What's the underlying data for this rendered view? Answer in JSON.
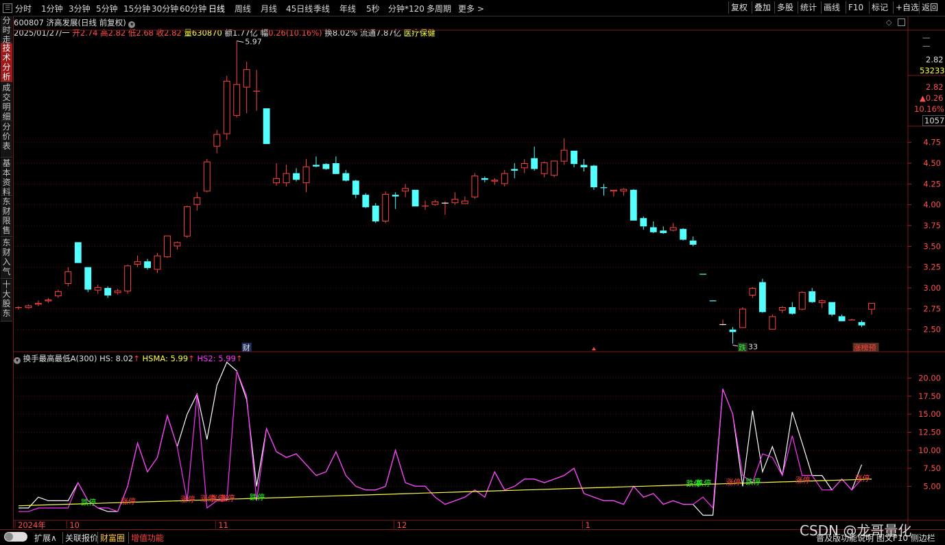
{
  "timeframes": [
    "分时",
    "1分钟",
    "3分钟",
    "5分钟",
    "15分钟",
    "30分钟",
    "60分钟",
    "日线",
    "周线",
    "月线",
    "45日线",
    "季线",
    "年线",
    "5秒",
    "分钟*120",
    "多周期",
    "更多 >"
  ],
  "active_timeframe": "日线",
  "right_buttons": [
    "复权",
    "叠加",
    "多股",
    "统计",
    "画线",
    "F10",
    "标记",
    "+自选",
    "返回"
  ],
  "sidebar": [
    "分时走势",
    "技术分析",
    "成交明细",
    "分价表",
    "基本资料",
    "东财限售",
    "东财入气",
    "十大股东"
  ],
  "stock": {
    "code_name": "600807 济高发展(日线 前复权)",
    "date": "2025/01/27/一",
    "open_label": "开",
    "open": "2.74",
    "high_label": "高",
    "high": "2.82",
    "low_label": "低",
    "low": "2.68",
    "close_label": "收",
    "close": "2.82",
    "vol_label": "量",
    "vol": "630870",
    "amount_label": "额",
    "amount": "1.77亿",
    "chg_label": "幅",
    "chg": "0.26(10.16%)",
    "turnover_label": "换",
    "turnover": "8.02%",
    "float_label": "流通",
    "float": "7.87亿",
    "sector": "医疗保健"
  },
  "right_panel": {
    "price": "2.82",
    "vol": "53233",
    "price2": "2.82",
    "chg": "▲0.26",
    "pct": "10.16%",
    "num": "1057"
  },
  "price_axis": [
    "4.75",
    "4.50",
    "4.25",
    "4.00",
    "3.75",
    "3.50",
    "3.25",
    "3.00",
    "2.75",
    "2.50"
  ],
  "max_label": "5.97",
  "min_label": "2.33",
  "markers": {
    "cai": "财",
    "die": "跌",
    "zhang_yu": "涨榜预"
  },
  "indicator": {
    "title": "换手最高最低A(300)",
    "hs": "HS: 8.02",
    "hsma": "HSMA: 5.99",
    "hs2": "HS2: 5.99",
    "axis": [
      "20.00",
      "17.50",
      "15.00",
      "12.50",
      "10.00",
      "7.50",
      "5.00"
    ]
  },
  "date_axis": [
    "2024年",
    "10",
    "11",
    "12",
    "1"
  ],
  "bottom_tabs": [
    "扩展∧",
    "关联报价",
    "财富圈",
    "增值功能"
  ],
  "bottom_right": "普及版功能说明  图文F10  侧边栏",
  "watermark": "CSDN @龙哥量化",
  "colors": {
    "up": "#ff4444",
    "down": "#54ffff",
    "white_line": "#ffffff",
    "magenta": "#ff33ff",
    "yellow": "#ffff44"
  },
  "chart_data": {
    "type": "candlestick",
    "ylim": [
      2.3,
      6.0
    ],
    "candles": [
      [
        2.76,
        2.78,
        2.74,
        2.77
      ],
      [
        2.76,
        2.8,
        2.75,
        2.79
      ],
      [
        2.8,
        2.85,
        2.78,
        2.82
      ],
      [
        2.84,
        2.88,
        2.82,
        2.86
      ],
      [
        2.9,
        2.98,
        2.88,
        2.96
      ],
      [
        3.05,
        3.25,
        3.02,
        3.2
      ],
      [
        3.55,
        3.55,
        3.3,
        3.3
      ],
      [
        3.25,
        3.25,
        2.95,
        2.98
      ],
      [
        2.97,
        3.04,
        2.93,
        3.01
      ],
      [
        3.0,
        3.02,
        2.88,
        2.91
      ],
      [
        2.94,
        2.99,
        2.92,
        2.97
      ],
      [
        2.96,
        3.28,
        2.93,
        3.27
      ],
      [
        3.28,
        3.39,
        3.25,
        3.32
      ],
      [
        3.32,
        3.35,
        3.22,
        3.24
      ],
      [
        3.22,
        3.42,
        3.18,
        3.39
      ],
      [
        3.37,
        3.62,
        3.36,
        3.63
      ],
      [
        3.5,
        3.56,
        3.46,
        3.55
      ],
      [
        3.62,
        3.99,
        3.6,
        3.98
      ],
      [
        4.0,
        4.15,
        3.93,
        4.09
      ],
      [
        4.16,
        4.55,
        4.15,
        4.52
      ],
      [
        4.7,
        4.9,
        4.62,
        4.85
      ],
      [
        4.85,
        5.55,
        4.78,
        5.49
      ],
      [
        5.07,
        5.97,
        5.05,
        5.45
      ],
      [
        5.41,
        5.72,
        5.1,
        5.63
      ],
      [
        5.36,
        5.62,
        5.13,
        5.37
      ],
      [
        5.16,
        5.16,
        4.73,
        4.73
      ],
      [
        4.26,
        4.5,
        4.23,
        4.32
      ],
      [
        4.26,
        4.48,
        4.22,
        4.38
      ],
      [
        4.38,
        4.44,
        4.28,
        4.3
      ],
      [
        4.26,
        4.55,
        4.15,
        4.46
      ],
      [
        4.48,
        4.58,
        4.45,
        4.46
      ],
      [
        4.49,
        4.5,
        4.42,
        4.43
      ],
      [
        4.5,
        4.58,
        4.38,
        4.37
      ],
      [
        4.38,
        4.42,
        4.28,
        4.29
      ],
      [
        4.29,
        4.3,
        4.08,
        4.12
      ],
      [
        4.12,
        4.14,
        3.96,
        3.97
      ],
      [
        3.99,
        4.02,
        3.78,
        3.8
      ],
      [
        3.8,
        4.16,
        3.78,
        4.13
      ],
      [
        4.12,
        4.15,
        3.95,
        4.1
      ],
      [
        4.16,
        4.25,
        4.09,
        4.2
      ],
      [
        4.18,
        4.18,
        3.98,
        3.98
      ],
      [
        3.98,
        4.05,
        3.94,
        3.99
      ],
      [
        4.0,
        4.06,
        3.99,
        4.04
      ],
      [
        4.02,
        4.04,
        3.88,
        4.02
      ],
      [
        4.02,
        4.15,
        4.0,
        4.07
      ],
      [
        4.01,
        4.1,
        4.01,
        4.05
      ],
      [
        4.09,
        4.38,
        4.07,
        4.35
      ],
      [
        4.32,
        4.34,
        4.27,
        4.3
      ],
      [
        4.28,
        4.32,
        4.24,
        4.3
      ],
      [
        4.25,
        4.42,
        4.22,
        4.38
      ],
      [
        4.43,
        4.5,
        4.32,
        4.41
      ],
      [
        4.44,
        4.55,
        4.38,
        4.5
      ],
      [
        4.56,
        4.7,
        4.41,
        4.43
      ],
      [
        4.37,
        4.52,
        4.33,
        4.51
      ],
      [
        4.35,
        4.52,
        4.33,
        4.53
      ],
      [
        4.52,
        4.8,
        4.48,
        4.66
      ],
      [
        4.65,
        4.65,
        4.45,
        4.49
      ],
      [
        4.48,
        4.55,
        4.4,
        4.45
      ],
      [
        4.47,
        4.48,
        4.18,
        4.21
      ],
      [
        4.21,
        4.25,
        4.11,
        4.2
      ],
      [
        4.16,
        4.18,
        4.1,
        4.18
      ],
      [
        4.16,
        4.2,
        4.11,
        4.19
      ],
      [
        4.18,
        4.19,
        3.81,
        3.81
      ],
      [
        3.84,
        3.86,
        3.7,
        3.74
      ],
      [
        3.73,
        3.8,
        3.66,
        3.67
      ],
      [
        3.69,
        3.74,
        3.65,
        3.66
      ],
      [
        3.69,
        3.78,
        3.68,
        3.73
      ],
      [
        3.71,
        3.72,
        3.57,
        3.58
      ],
      [
        3.57,
        3.62,
        3.5,
        3.52
      ],
      [
        3.17,
        3.17,
        3.16,
        3.16
      ],
      [
        2.85,
        2.85,
        2.84,
        2.84
      ],
      [
        2.56,
        2.62,
        2.55,
        2.56
      ],
      [
        2.5,
        2.53,
        2.33,
        2.47
      ],
      [
        2.52,
        2.77,
        2.52,
        2.75
      ],
      [
        2.91,
        3.01,
        2.88,
        3.0
      ],
      [
        3.07,
        3.11,
        2.7,
        2.71
      ],
      [
        2.5,
        2.68,
        2.5,
        2.66
      ],
      [
        2.73,
        2.78,
        2.7,
        2.77
      ],
      [
        2.77,
        2.83,
        2.68,
        2.69
      ],
      [
        2.74,
        2.96,
        2.73,
        2.95
      ],
      [
        2.96,
        3.0,
        2.82,
        2.83
      ],
      [
        2.82,
        2.86,
        2.76,
        2.85
      ],
      [
        2.83,
        2.83,
        2.66,
        2.68
      ],
      [
        2.66,
        2.68,
        2.6,
        2.6
      ],
      [
        2.61,
        2.63,
        2.61,
        2.62
      ],
      [
        2.59,
        2.61,
        2.53,
        2.55
      ],
      [
        2.74,
        2.82,
        2.68,
        2.82
      ]
    ],
    "hs": [
      2.0,
      2.0,
      3.5,
      3.0,
      3.0,
      3.0,
      5.5,
      3.0,
      2.0,
      1.5,
      1.5,
      5.0,
      11.0,
      7.0,
      9.0,
      14.8,
      10.5,
      15.0,
      17.8,
      11.5,
      19.0,
      22.2,
      21.0,
      17.0,
      5.0,
      13.0,
      9.8,
      9.0,
      9.5,
      8.0,
      6.5,
      7.0,
      9.8,
      6.5,
      5.0,
      4.5,
      4.5,
      5.0,
      10.0,
      5.5,
      5.0,
      5.0,
      3.5,
      2.5,
      3.0,
      3.5,
      4.5,
      3.5,
      7.0,
      4.5,
      5.0,
      6.0,
      6.0,
      5.5,
      6.0,
      6.5,
      7.5,
      4.0,
      3.5,
      3.0,
      3.0,
      2.5,
      5.0,
      3.5,
      4.0,
      2.5,
      3.0,
      2.5,
      2.5,
      1.0,
      1.0,
      18.5,
      15.0,
      5.0,
      15.5,
      7.0,
      10.5,
      6.5,
      15.3,
      11.0,
      6.5,
      6.5,
      4.5,
      6.0,
      4.5,
      8.0
    ],
    "hs2": [
      1.5,
      1.5,
      2.0,
      2.0,
      2.0,
      2.0,
      5.5,
      3.0,
      2.0,
      2.0,
      1.5,
      5.0,
      11.0,
      7.0,
      9.0,
      14.8,
      10.5,
      3.0,
      17.8,
      2.0,
      3.0,
      3.0,
      21.0,
      17.5,
      3.0,
      13.0,
      9.8,
      9.0,
      9.5,
      8.0,
      6.5,
      7.0,
      9.8,
      6.5,
      5.0,
      4.5,
      4.5,
      5.0,
      10.0,
      5.5,
      5.0,
      5.0,
      3.5,
      2.5,
      3.0,
      3.5,
      4.5,
      3.5,
      7.0,
      4.5,
      5.0,
      6.0,
      6.0,
      5.5,
      6.0,
      6.5,
      7.5,
      4.0,
      3.5,
      3.0,
      3.0,
      2.5,
      5.0,
      3.5,
      4.0,
      2.5,
      3.0,
      2.5,
      2.5,
      3.5,
      2.0,
      18.5,
      15.0,
      6.5,
      5.5,
      9.5,
      9.0,
      6.5,
      12.0,
      6.5,
      6.5,
      4.5,
      4.5,
      6.0,
      4.5,
      6.0
    ],
    "hsma": [
      2.3,
      6.0
    ],
    "ind_ylim": [
      0,
      23
    ],
    "ind_labels": [
      {
        "i": 7,
        "t": "跌停",
        "c": "down"
      },
      {
        "i": 11,
        "t": "涨停",
        "c": "up"
      },
      {
        "i": 17,
        "t": "涨停",
        "c": "up"
      },
      {
        "i": 19,
        "t": "涨停",
        "c": "up"
      },
      {
        "i": 20,
        "t": "涨停",
        "c": "up"
      },
      {
        "i": 21,
        "t": "涨停",
        "c": "up"
      },
      {
        "i": 24,
        "t": "跌停",
        "c": "down"
      },
      {
        "i": 68,
        "t": "跌停",
        "c": "down"
      },
      {
        "i": 69,
        "t": "跌停",
        "c": "down"
      },
      {
        "i": 72,
        "t": "涨停",
        "c": "up"
      },
      {
        "i": 74,
        "t": "跌停",
        "c": "down"
      },
      {
        "i": 79,
        "t": "涨停",
        "c": "up"
      },
      {
        "i": 85,
        "t": "涨停",
        "c": "up"
      }
    ]
  }
}
